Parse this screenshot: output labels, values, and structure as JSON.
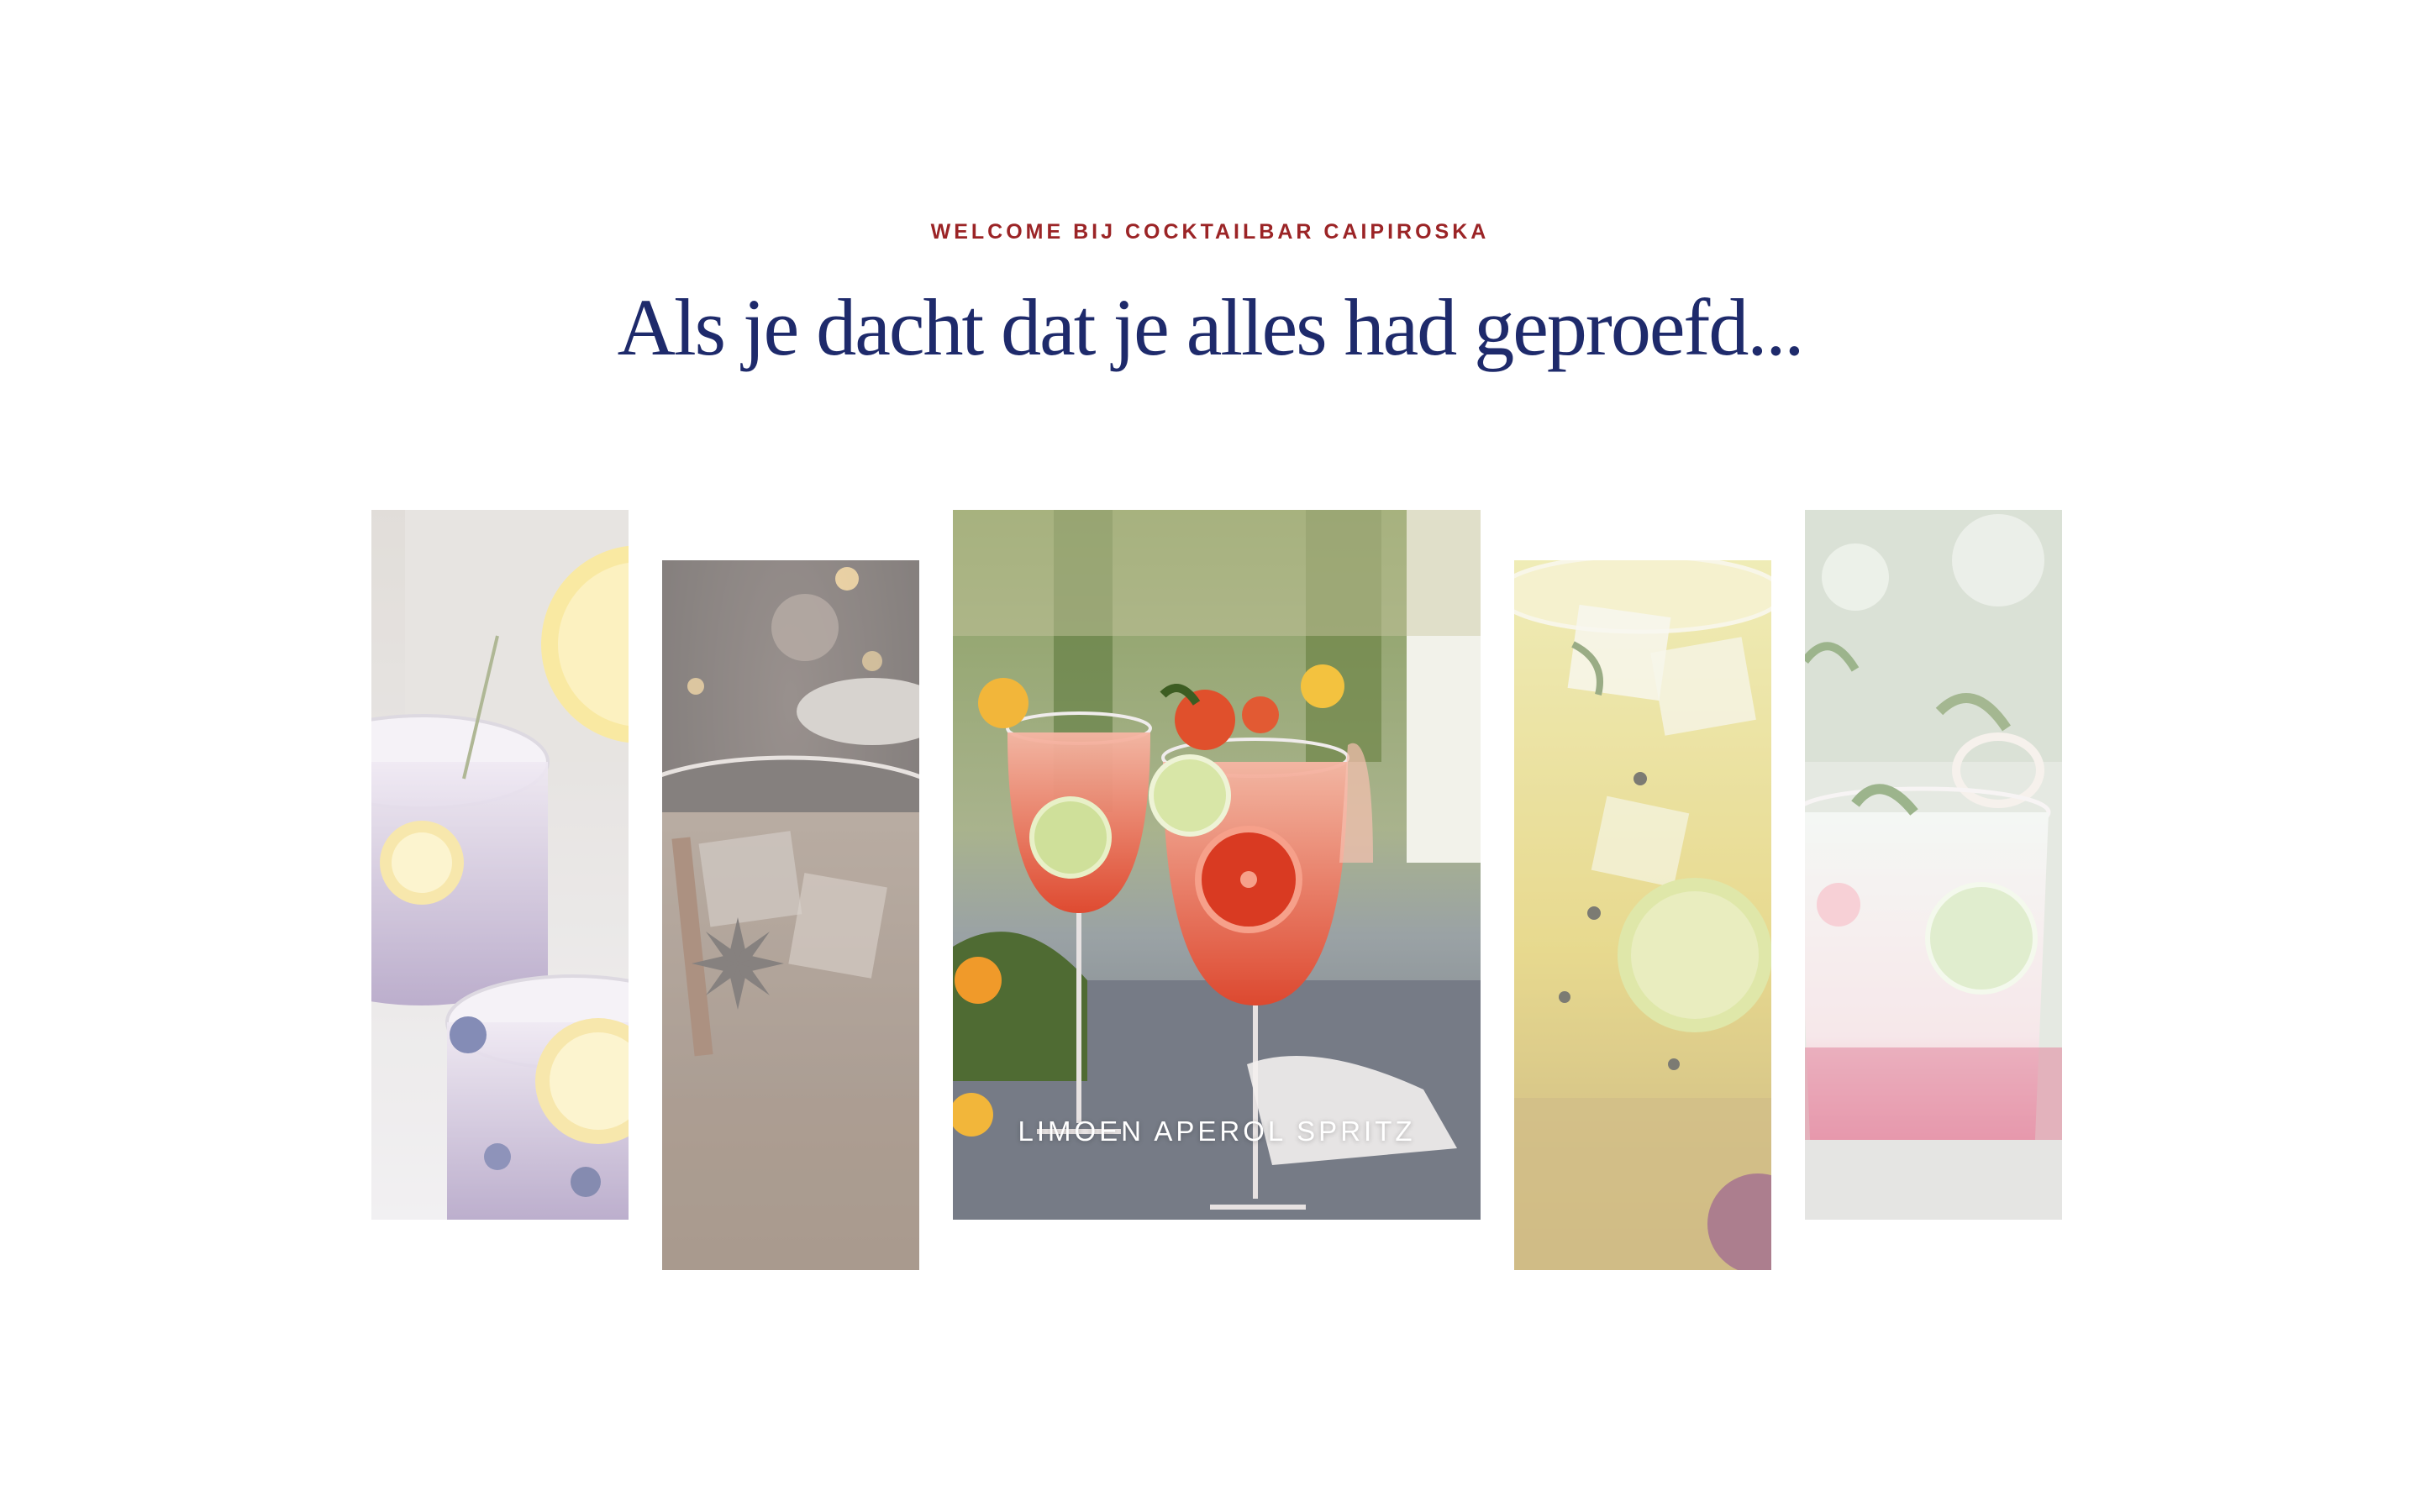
{
  "hero": {
    "eyebrow": "WELCOME BIJ COCKTAILBAR CAIPIROSKA",
    "headline": "Als je dacht dat je alles had geproefd..."
  },
  "gallery": {
    "active_index": 2,
    "items": [
      {
        "name": "lemon blueberry cocktail",
        "caption": ""
      },
      {
        "name": "spiced cinnamon cocktail",
        "caption": ""
      },
      {
        "name": "limoen aperol spritz",
        "caption": "LIMOEN APEROL SPRITZ"
      },
      {
        "name": "passionfruit cocktail",
        "caption": ""
      },
      {
        "name": "raspberry mint cocktail",
        "caption": ""
      }
    ]
  },
  "colors": {
    "eyebrow": "#9b2426",
    "headline": "#1e2a6b",
    "background": "#ffffff"
  }
}
